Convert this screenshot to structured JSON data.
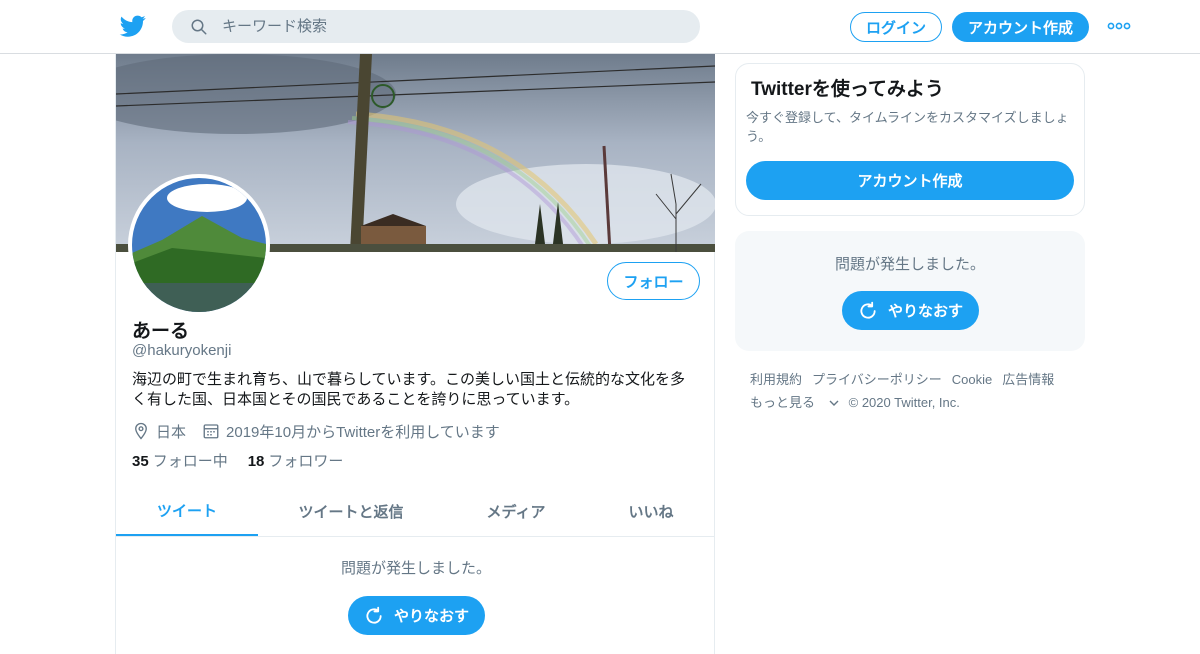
{
  "header": {
    "search_placeholder": "キーワード検索",
    "login_label": "ログイン",
    "signup_label": "アカウント作成",
    "brand_color": "#1da1f2"
  },
  "profile": {
    "follow_label": "フォロー",
    "name": "あーる",
    "handle": "@hakuryokenji",
    "bio": "海辺の町で生まれ育ち、山で暮らしています。この美しい国土と伝統的な文化を多く有した国、日本国とその国民であることを誇りに思っています。",
    "location": "日本",
    "joined": "2019年10月からTwitterを利用しています",
    "following_count": "35",
    "following_label": "フォロー中",
    "followers_count": "18",
    "followers_label": "フォロワー"
  },
  "tabs": [
    {
      "label": "ツイート",
      "active": true
    },
    {
      "label": "ツイートと返信",
      "active": false
    },
    {
      "label": "メディア",
      "active": false
    },
    {
      "label": "いいね",
      "active": false
    }
  ],
  "timeline": {
    "error_text": "問題が発生しました。",
    "retry_label": "やりなおす"
  },
  "sidebar": {
    "signup_card": {
      "title": "Twitterを使ってみよう",
      "description": "今すぐ登録して、タイムラインをカスタマイズしましょう。",
      "cta_label": "アカウント作成"
    },
    "error_box": {
      "error_text": "問題が発生しました。",
      "retry_label": "やりなおす"
    },
    "footer": {
      "links": [
        "利用規約",
        "プライバシーポリシー",
        "Cookie",
        "広告情報"
      ],
      "more_label": "もっと見る",
      "copyright": "© 2020 Twitter, Inc."
    }
  }
}
